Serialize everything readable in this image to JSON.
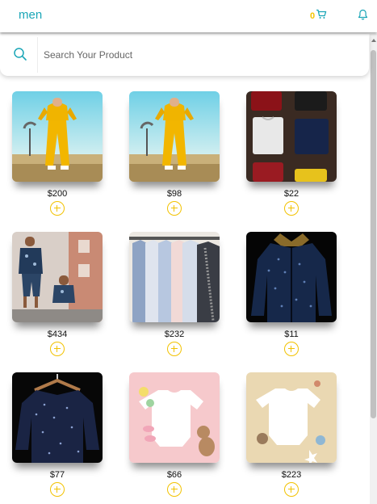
{
  "header": {
    "title": "men",
    "cart_count": "0"
  },
  "search": {
    "placeholder": "Search Your Product",
    "value": ""
  },
  "colors": {
    "accent": "#1aa6b7",
    "highlight": "#f2c200"
  },
  "products": [
    {
      "image": "yellow-tracksuit-photo",
      "price": "$200"
    },
    {
      "image": "yellow-tracksuit-photo",
      "price": "$98"
    },
    {
      "image": "folded-tshirts-photo",
      "price": "$22"
    },
    {
      "image": "father-son-matching-outfit-photo",
      "price": "$434"
    },
    {
      "image": "shirts-on-rack-photo",
      "price": "$232"
    },
    {
      "image": "sequin-jacket-photo",
      "price": "$11"
    },
    {
      "image": "sparkly-sweater-on-hanger-photo",
      "price": "$77"
    },
    {
      "image": "baby-onesie-pink-photo",
      "price": "$66"
    },
    {
      "image": "baby-onesie-beige-photo",
      "price": "$223"
    }
  ]
}
